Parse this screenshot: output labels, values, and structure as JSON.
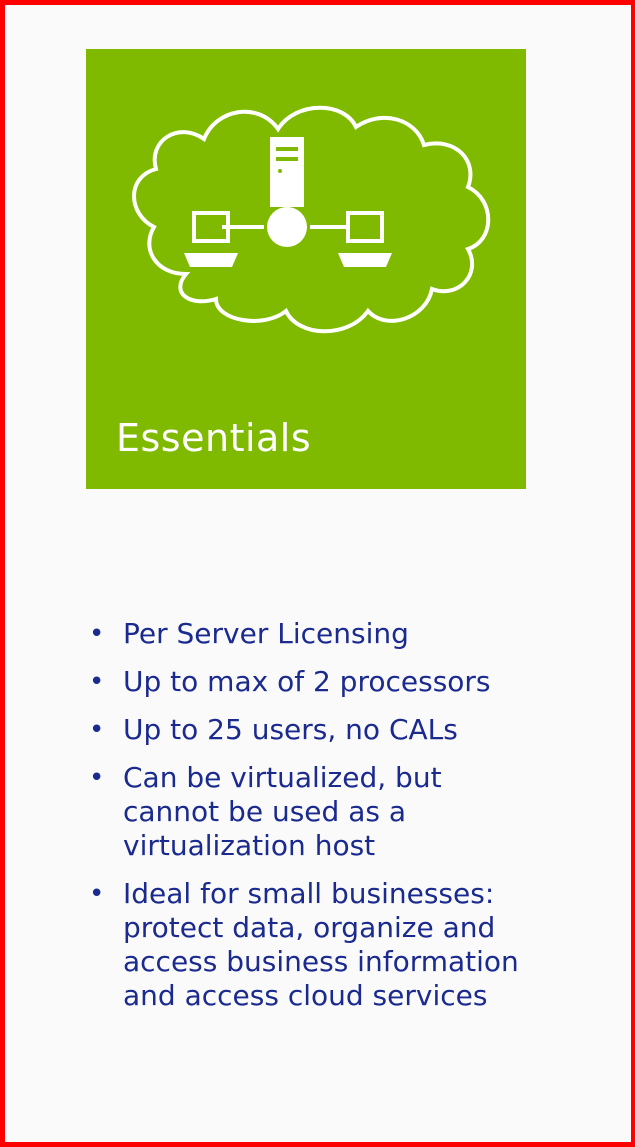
{
  "tile": {
    "title": "Essentials",
    "background_color": "#7fba00",
    "icon": "cloud-network-icon"
  },
  "features": [
    {
      "lines": [
        "Per Server Licensing"
      ]
    },
    {
      "lines": [
        "Up to max of 2 processors"
      ]
    },
    {
      "lines": [
        "Up to 25 users, no CALs"
      ]
    },
    {
      "lines": [
        "Can be virtualized, but",
        "cannot be used as a",
        "virtualization host"
      ]
    },
    {
      "lines": [
        "Ideal for small businesses:",
        "protect data, organize and",
        "access business information",
        "and access cloud services"
      ]
    }
  ],
  "colors": {
    "frame_border": "#ff0000",
    "text": "#1a2a8e",
    "tile_icon": "#ffffff"
  }
}
